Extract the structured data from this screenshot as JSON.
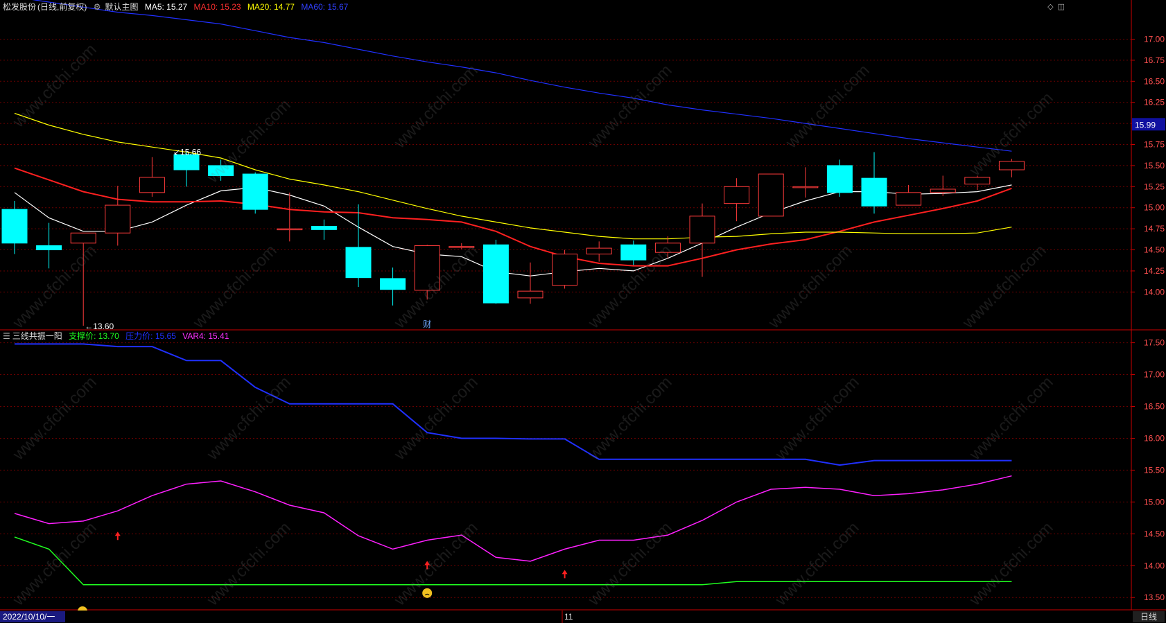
{
  "main": {
    "stock_name": "松发股份",
    "period_label": "(日线,前复权)",
    "chart_label": "默认主图",
    "ma": [
      {
        "label": "MA5: 15.27",
        "color": "#ffffff"
      },
      {
        "label": "MA10: 15.23",
        "color": "#ff2020"
      },
      {
        "label": "MA20: 14.77",
        "color": "#ffff00"
      },
      {
        "label": "MA60: 15.67",
        "color": "#2030ff"
      }
    ],
    "price_tag": "15.99",
    "high_label": "15.66",
    "low_label": "13.60",
    "event_marker": "财"
  },
  "sub": {
    "title": "三线共振一阳",
    "support_label": "支撑价: 13.70",
    "resist_label": "压力价: 15.65",
    "var4_label": "VAR4: 15.41"
  },
  "footer": {
    "date_label": "2022/10/10/一",
    "month_label": "11",
    "period_button": "日线"
  },
  "watermark": "www.cfchi.com",
  "colors": {
    "up": "#ff3b3b",
    "down": "#00ffff",
    "bg": "#000000",
    "grid": "#6a0000",
    "axis": "#cc0000",
    "ma5": "#ffffff",
    "ma10": "#ff2020",
    "ma20": "#ffff00",
    "ma60": "#2030ff",
    "support": "#20ff20",
    "resist": "#2030ff",
    "var4": "#ff20ff",
    "arrow": "#ff2020"
  },
  "chart_data": [
    {
      "type": "candlestick",
      "title": "",
      "ylim": [
        13.6,
        17.3
      ],
      "yticks": [
        14.0,
        14.25,
        14.5,
        14.75,
        15.0,
        15.25,
        15.5,
        15.75,
        16.0,
        16.25,
        16.5,
        16.75,
        17.0
      ],
      "candles": [
        {
          "o": 14.98,
          "h": 15.08,
          "l": 14.45,
          "c": 14.58
        },
        {
          "o": 14.55,
          "h": 14.82,
          "l": 14.28,
          "c": 14.5
        },
        {
          "o": 14.58,
          "h": 14.7,
          "l": 13.6,
          "c": 14.7
        },
        {
          "o": 14.7,
          "h": 15.26,
          "l": 14.55,
          "c": 15.03
        },
        {
          "o": 15.18,
          "h": 15.6,
          "l": 15.13,
          "c": 15.36
        },
        {
          "o": 15.63,
          "h": 15.66,
          "l": 15.25,
          "c": 15.45
        },
        {
          "o": 15.5,
          "h": 15.57,
          "l": 15.32,
          "c": 15.38
        },
        {
          "o": 15.4,
          "h": 15.42,
          "l": 14.93,
          "c": 14.98
        },
        {
          "o": 14.75,
          "h": 15.18,
          "l": 14.6,
          "c": 14.75
        },
        {
          "o": 14.78,
          "h": 14.86,
          "l": 14.62,
          "c": 14.74
        },
        {
          "o": 14.53,
          "h": 15.04,
          "l": 14.06,
          "c": 14.17
        },
        {
          "o": 14.16,
          "h": 14.29,
          "l": 13.84,
          "c": 14.03
        },
        {
          "o": 14.02,
          "h": 14.56,
          "l": 13.91,
          "c": 14.55
        },
        {
          "o": 14.53,
          "h": 14.58,
          "l": 14.51,
          "c": 14.54
        },
        {
          "o": 14.56,
          "h": 14.62,
          "l": 13.86,
          "c": 13.87
        },
        {
          "o": 13.93,
          "h": 14.35,
          "l": 13.86,
          "c": 14.01
        },
        {
          "o": 14.08,
          "h": 14.5,
          "l": 14.04,
          "c": 14.45
        },
        {
          "o": 14.45,
          "h": 14.6,
          "l": 14.36,
          "c": 14.52
        },
        {
          "o": 14.56,
          "h": 14.61,
          "l": 14.32,
          "c": 14.38
        },
        {
          "o": 14.47,
          "h": 14.66,
          "l": 14.4,
          "c": 14.58
        },
        {
          "o": 14.58,
          "h": 15.05,
          "l": 14.18,
          "c": 14.9
        },
        {
          "o": 15.05,
          "h": 15.35,
          "l": 14.84,
          "c": 15.25
        },
        {
          "o": 14.9,
          "h": 15.4,
          "l": 14.9,
          "c": 15.4
        },
        {
          "o": 15.25,
          "h": 15.48,
          "l": 15.12,
          "c": 15.25
        },
        {
          "o": 15.5,
          "h": 15.57,
          "l": 15.13,
          "c": 15.18
        },
        {
          "o": 15.35,
          "h": 15.66,
          "l": 14.93,
          "c": 15.02
        },
        {
          "o": 15.03,
          "h": 15.27,
          "l": 15.03,
          "c": 15.18
        },
        {
          "o": 15.18,
          "h": 15.38,
          "l": 15.14,
          "c": 15.22
        },
        {
          "o": 15.28,
          "h": 15.38,
          "l": 15.21,
          "c": 15.36
        },
        {
          "o": 15.45,
          "h": 15.58,
          "l": 15.36,
          "c": 15.55
        }
      ],
      "series": [
        {
          "name": "MA5",
          "values": [
            15.18,
            14.88,
            14.72,
            14.72,
            14.83,
            15.03,
            15.2,
            15.24,
            15.15,
            15.02,
            14.77,
            14.54,
            14.45,
            14.42,
            14.24,
            14.19,
            14.24,
            14.28,
            14.25,
            14.4,
            14.58,
            14.77,
            14.94,
            15.08,
            15.19,
            15.19,
            15.16,
            15.17,
            15.19,
            15.27
          ]
        },
        {
          "name": "MA10",
          "values": [
            15.47,
            15.33,
            15.19,
            15.1,
            15.07,
            15.07,
            15.08,
            15.04,
            14.98,
            14.95,
            14.94,
            14.88,
            14.86,
            14.83,
            14.72,
            14.54,
            14.42,
            14.34,
            14.31,
            14.31,
            14.4,
            14.5,
            14.57,
            14.62,
            14.72,
            14.83,
            14.91,
            14.99,
            15.08,
            15.23
          ]
        },
        {
          "name": "MA20",
          "values": [
            16.12,
            15.98,
            15.87,
            15.78,
            15.72,
            15.66,
            15.59,
            15.45,
            15.34,
            15.27,
            15.19,
            15.09,
            14.99,
            14.9,
            14.83,
            14.76,
            14.71,
            14.66,
            14.63,
            14.63,
            14.65,
            14.66,
            14.69,
            14.71,
            14.71,
            14.7,
            14.69,
            14.69,
            14.7,
            14.77
          ]
        },
        {
          "name": "MA60",
          "values": [
            17.5,
            17.44,
            17.38,
            17.32,
            17.28,
            17.23,
            17.18,
            17.1,
            17.02,
            16.96,
            16.88,
            16.8,
            16.73,
            16.67,
            16.6,
            16.51,
            16.43,
            16.36,
            16.3,
            16.22,
            16.16,
            16.11,
            16.06,
            16.0,
            15.94,
            15.88,
            15.82,
            15.77,
            15.72,
            15.67
          ]
        }
      ]
    },
    {
      "type": "line",
      "title": "",
      "ylim": [
        13.35,
        17.55
      ],
      "yticks": [
        13.5,
        14.0,
        14.5,
        15.0,
        15.5,
        16.0,
        16.5,
        17.0,
        17.5
      ],
      "series": [
        {
          "name": "支撑价",
          "values": [
            14.45,
            14.26,
            13.7,
            13.7,
            13.7,
            13.7,
            13.7,
            13.7,
            13.7,
            13.7,
            13.7,
            13.7,
            13.7,
            13.7,
            13.7,
            13.7,
            13.7,
            13.7,
            13.7,
            13.7,
            13.7,
            13.75,
            13.75,
            13.75,
            13.75,
            13.75,
            13.75,
            13.75,
            13.75,
            13.75
          ]
        },
        {
          "name": "压力价",
          "values": [
            17.48,
            17.48,
            17.48,
            17.44,
            17.44,
            17.22,
            17.22,
            16.8,
            16.54,
            16.54,
            16.54,
            16.54,
            16.09,
            16.0,
            16.0,
            15.99,
            15.99,
            15.67,
            15.67,
            15.67,
            15.67,
            15.67,
            15.67,
            15.67,
            15.58,
            15.65,
            15.65,
            15.65,
            15.65,
            15.65
          ]
        },
        {
          "name": "VAR4",
          "values": [
            14.82,
            14.66,
            14.7,
            14.86,
            15.1,
            15.28,
            15.33,
            15.16,
            14.95,
            14.83,
            14.47,
            14.26,
            14.4,
            14.48,
            14.13,
            14.07,
            14.26,
            14.4,
            14.4,
            14.48,
            14.71,
            15.0,
            15.2,
            15.23,
            15.2,
            15.1,
            15.13,
            15.19,
            15.28,
            15.41
          ]
        }
      ],
      "arrows_at": [
        3,
        12,
        16
      ],
      "face_at": [
        12
      ]
    }
  ]
}
